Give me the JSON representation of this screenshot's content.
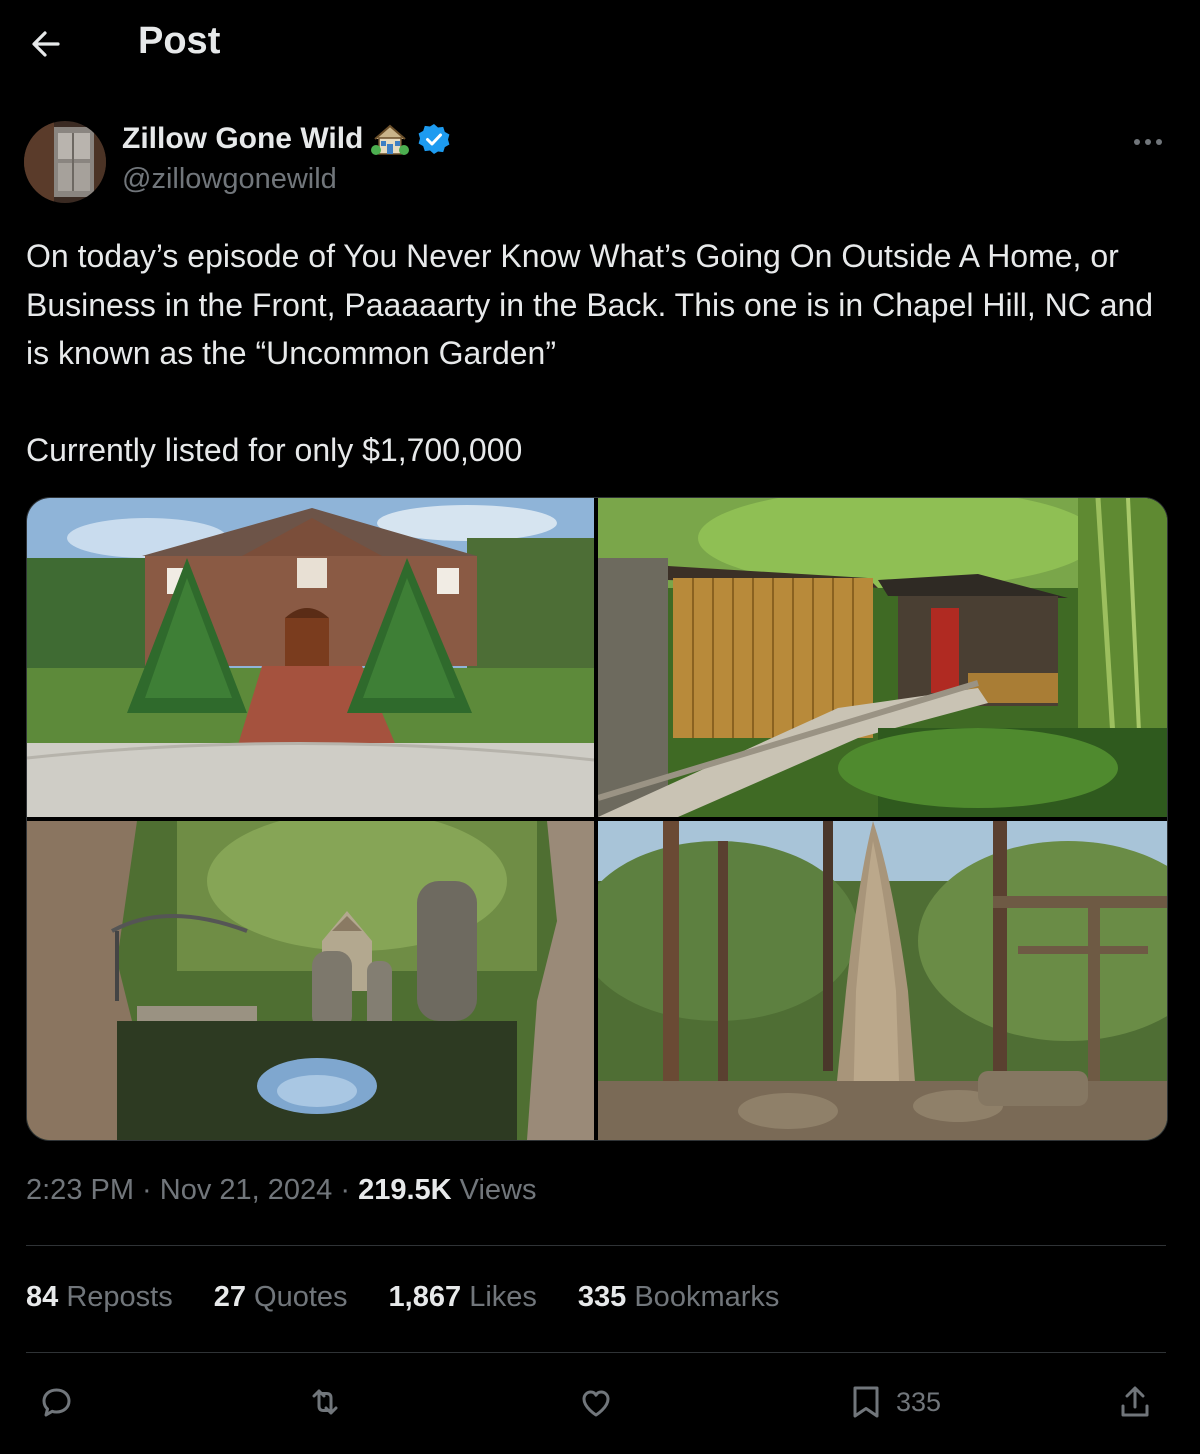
{
  "header": {
    "title": "Post"
  },
  "author": {
    "name": "Zillow Gone Wild",
    "handle": "@zillowgonewild",
    "emoji_icon": "house-with-garden-icon",
    "verified_icon": "verified-badge-icon"
  },
  "post": {
    "text_paragraph_1": "On today’s episode of You Never Know What’s Going On Outside A Home, or Business in the Front, Paaaaarty in the Back. This one is in Chapel Hill, NC and is known as the “Uncommon Garden”",
    "text_paragraph_2": "Currently listed for only $1,700,000",
    "images": [
      {
        "subject": "brick-house-front-with-evergreen-trees"
      },
      {
        "subject": "bamboo-clad-cottage-with-red-door"
      },
      {
        "subject": "rock-pond-with-gazebo"
      },
      {
        "subject": "stone-spire-sculpture-in-forest"
      }
    ]
  },
  "meta": {
    "time": "2:23 PM",
    "separator": " · ",
    "date": "Nov 21, 2024",
    "views_count": "219.5K",
    "views_label": "Views"
  },
  "stats": {
    "reposts_count": "84",
    "reposts_label": "Reposts",
    "quotes_count": "27",
    "quotes_label": "Quotes",
    "likes_count": "1,867",
    "likes_label": "Likes",
    "bookmarks_count": "335",
    "bookmarks_label": "Bookmarks"
  },
  "actions": {
    "reply_icon": "reply-icon",
    "repost_icon": "repost-icon",
    "like_icon": "heart-icon",
    "bookmark_icon": "bookmark-icon",
    "bookmark_count": "335",
    "share_icon": "share-icon"
  },
  "colors": {
    "background": "#000000",
    "text_primary": "#e7e9ea",
    "text_secondary": "#71767b",
    "divider": "#2f3336",
    "verified_blue": "#1d9bf0"
  }
}
